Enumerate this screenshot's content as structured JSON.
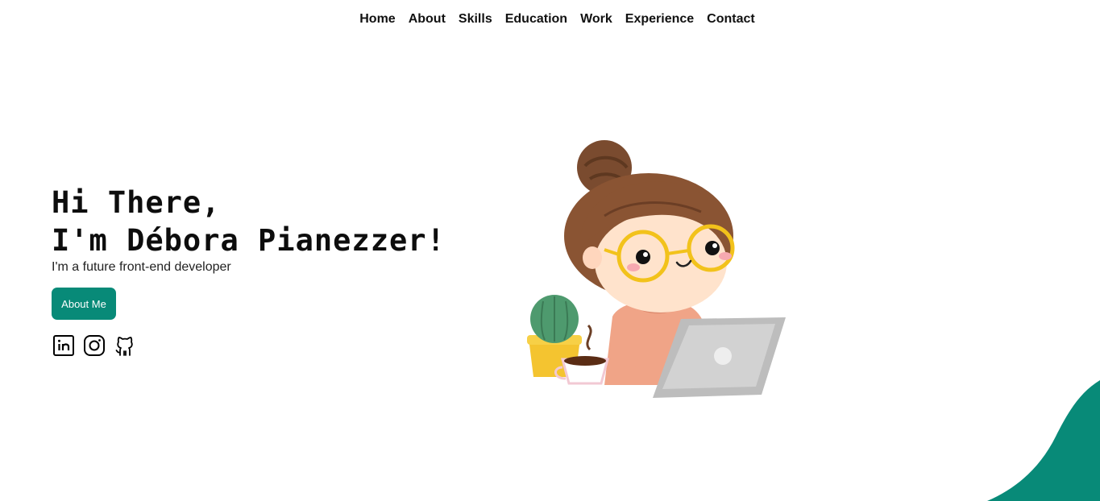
{
  "nav": {
    "items": [
      {
        "label": "Home"
      },
      {
        "label": "About"
      },
      {
        "label": "Skills"
      },
      {
        "label": "Education"
      },
      {
        "label": "Work"
      },
      {
        "label": "Experience"
      },
      {
        "label": "Contact"
      }
    ]
  },
  "hero": {
    "greeting": "Hi There,",
    "name_line": "I'm Débora Pianezzer!",
    "subtitle": "I'm a future front-end developer",
    "cta_label": "About Me"
  },
  "socials": [
    {
      "icon": "linkedin-icon"
    },
    {
      "icon": "instagram-icon"
    },
    {
      "icon": "github-icon"
    }
  ],
  "illustration": {
    "subject": "girl-with-laptop-illustration"
  },
  "colors": {
    "accent": "#088a78",
    "text": "#111111",
    "background": "#ffffff"
  }
}
